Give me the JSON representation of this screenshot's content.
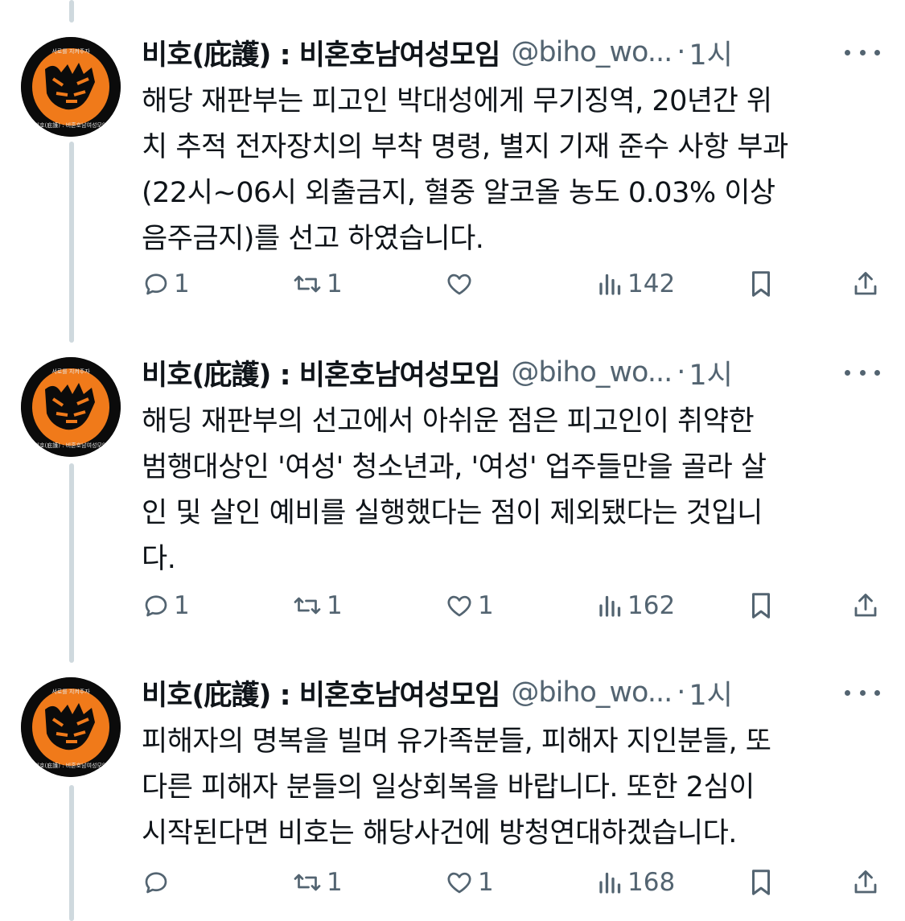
{
  "tweets": [
    {
      "author": {
        "name": "비호(庇護) : 비혼호남여성모임",
        "handle": "@biho_wo...",
        "separator": "·",
        "time": "1시",
        "avatar_ring_text": "비호(庇護) : 비혼호남여성모임",
        "avatar_top_text": "서로를 지켜주자"
      },
      "body_lines": [
        "해당 재판부는 피고인 박대성에게 무기징역, 20년간 위",
        "치 추적 전자장치의 부착 명령, 별지 기재 준수 사항 부과",
        "(22시~06시 외출금지, 혈중 알코올 농도 0.03% 이상",
        "음주금지)를  선고 하였습니다."
      ],
      "stats": {
        "replies": "1",
        "retweets": "1",
        "likes": "",
        "views": "142"
      }
    },
    {
      "author": {
        "name": "비호(庇護) : 비혼호남여성모임",
        "handle": "@biho_wo...",
        "separator": "·",
        "time": "1시",
        "avatar_ring_text": "비호(庇護) : 비혼호남여성모임",
        "avatar_top_text": "서로를 지켜주자"
      },
      "body_lines": [
        "해딩 재판부의 선고에서 아쉬운 점은 피고인이 취약한",
        "범행대상인 '여성' 청소년과, '여성' 업주들만을 골라 살",
        "인 및 살인 예비를 실행했다는 점이 제외됐다는 것입니",
        "다."
      ],
      "stats": {
        "replies": "1",
        "retweets": "1",
        "likes": "1",
        "views": "162"
      }
    },
    {
      "author": {
        "name": "비호(庇護) : 비혼호남여성모임",
        "handle": "@biho_wo...",
        "separator": "·",
        "time": "1시",
        "avatar_ring_text": "비호(庇護) : 비혼호남여성모임",
        "avatar_top_text": "서로를 지켜주자"
      },
      "body_lines": [
        "피해자의 명복을 빌며 유가족분들, 피해자 지인분들, 또",
        "다른 피해자 분들의 일상회복을 바랍니다. 또한 2심이",
        "시작된다면 비호는 해당사건에 방청연대하겠습니다."
      ],
      "stats": {
        "replies": "",
        "retweets": "1",
        "likes": "1",
        "views": "168"
      }
    }
  ],
  "icons": {
    "reply": "reply-icon",
    "retweet": "retweet-icon",
    "like": "heart-icon",
    "views": "views-icon",
    "bookmark": "bookmark-icon",
    "share": "share-icon",
    "more": "more-icon"
  },
  "colors": {
    "text": "#0f1419",
    "muted": "#536471",
    "thread_line": "#cfd9de",
    "avatar_bg": "#0b0b0b",
    "tiger_orange": "#f07a1a"
  }
}
